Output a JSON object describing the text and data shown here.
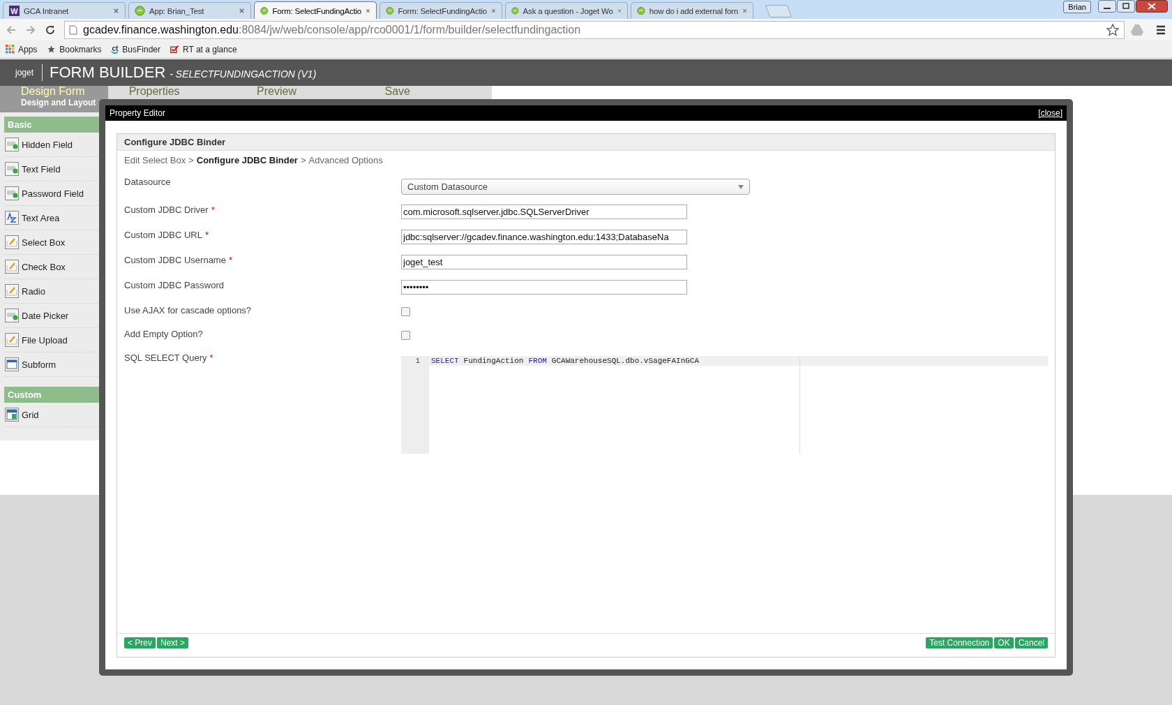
{
  "browser": {
    "tabs": [
      {
        "title": "GCA Intranet",
        "kind": "letter",
        "icon_text": "W",
        "selected": false
      },
      {
        "title": "App: Brian_Test",
        "kind": "globe",
        "selected": false
      },
      {
        "title": "Form: SelectFundingActio",
        "kind": "globe",
        "selected": true
      },
      {
        "title": "Form: SelectFundingActio",
        "kind": "globe",
        "selected": false
      },
      {
        "title": "Ask a question - Joget Wo",
        "kind": "globe",
        "selected": false
      },
      {
        "title": "how do i add external forn",
        "kind": "globe",
        "selected": false
      }
    ],
    "profile": "Brian",
    "address": {
      "host": "gcadev.finance.washington.edu",
      "path": ":8084/jw/web/console/app/rco0001/1/form/builder/selectfundingaction"
    },
    "bookmarks": [
      {
        "label": "Apps",
        "kind": "apps"
      },
      {
        "label": "Bookmarks",
        "kind": "star"
      },
      {
        "label": "BusFinder",
        "kind": "bus",
        "icon_text": "ct"
      },
      {
        "label": "RT at a glance",
        "kind": "check"
      }
    ]
  },
  "app": {
    "logo": "joget",
    "title": "FORM BUILDER",
    "subtitle": "- SELECTFUNDINGACTION (V1)",
    "steps": [
      {
        "label": "Design Form",
        "sublabel": "Design and Layout",
        "selected": true
      },
      {
        "label": "Properties",
        "selected": false
      },
      {
        "label": "Preview",
        "selected": false
      },
      {
        "label": "Save",
        "selected": false
      }
    ]
  },
  "sidebar": {
    "groups": [
      {
        "title": "Basic",
        "items": [
          {
            "label": "Hidden Field",
            "kind": "field"
          },
          {
            "label": "Text Field",
            "kind": "field"
          },
          {
            "label": "Password Field",
            "kind": "field"
          },
          {
            "label": "Text Area",
            "kind": "textarea"
          },
          {
            "label": "Select Box",
            "kind": "edit"
          },
          {
            "label": "Check Box",
            "kind": "edit"
          },
          {
            "label": "Radio",
            "kind": "edit"
          },
          {
            "label": "Date Picker",
            "kind": "field"
          },
          {
            "label": "File Upload",
            "kind": "edit"
          },
          {
            "label": "Subform",
            "kind": "subform"
          }
        ]
      },
      {
        "title": "Custom",
        "items": [
          {
            "label": "Grid",
            "kind": "grid"
          }
        ]
      }
    ]
  },
  "dialog": {
    "title": "Property Editor",
    "close": "[close]",
    "panel_title": "Configure JDBC Binder",
    "breadcrumb": [
      {
        "text": "Edit Select Box",
        "current": false
      },
      {
        "text": ">",
        "current": false
      },
      {
        "text": "Configure JDBC Binder",
        "current": true
      },
      {
        "text": ">",
        "current": false
      },
      {
        "text": "Advanced Options",
        "current": false
      }
    ],
    "fields": [
      {
        "kind": "select",
        "label": "Datasource",
        "required": false,
        "value": "Custom Datasource"
      },
      {
        "kind": "text",
        "label": "Custom JDBC Driver",
        "required": true,
        "value": "com.microsoft.sqlserver.jdbc.SQLServerDriver"
      },
      {
        "kind": "text",
        "label": "Custom JDBC URL",
        "required": true,
        "value": "jdbc:sqlserver://gcadev.finance.washington.edu:1433;DatabaseNa"
      },
      {
        "kind": "text",
        "label": "Custom JDBC Username",
        "required": true,
        "value": "joget_test"
      },
      {
        "kind": "text",
        "label": "Custom JDBC Password",
        "required": false,
        "value": "••••••••"
      },
      {
        "kind": "checkbox",
        "label": "Use AJAX for cascade options?",
        "required": false,
        "checked": false
      },
      {
        "kind": "checkbox",
        "label": "Add Empty Option?",
        "required": false,
        "checked": false
      },
      {
        "kind": "code",
        "label": "SQL SELECT Query",
        "required": true,
        "lines": [
          {
            "number": "1",
            "tokens": [
              {
                "text": "SELECT",
                "keyword": true
              },
              {
                "text": "FundingAction",
                "keyword": false
              },
              {
                "text": "FROM",
                "keyword": true
              },
              {
                "text": "GCAWarehouseSQL.dbo.vSageFAInGCA",
                "keyword": false
              }
            ]
          }
        ]
      }
    ],
    "required_mark": "*",
    "left_buttons": [
      "< Prev",
      "Next >"
    ],
    "right_buttons": [
      "Test Connection",
      "OK",
      "Cancel"
    ]
  }
}
